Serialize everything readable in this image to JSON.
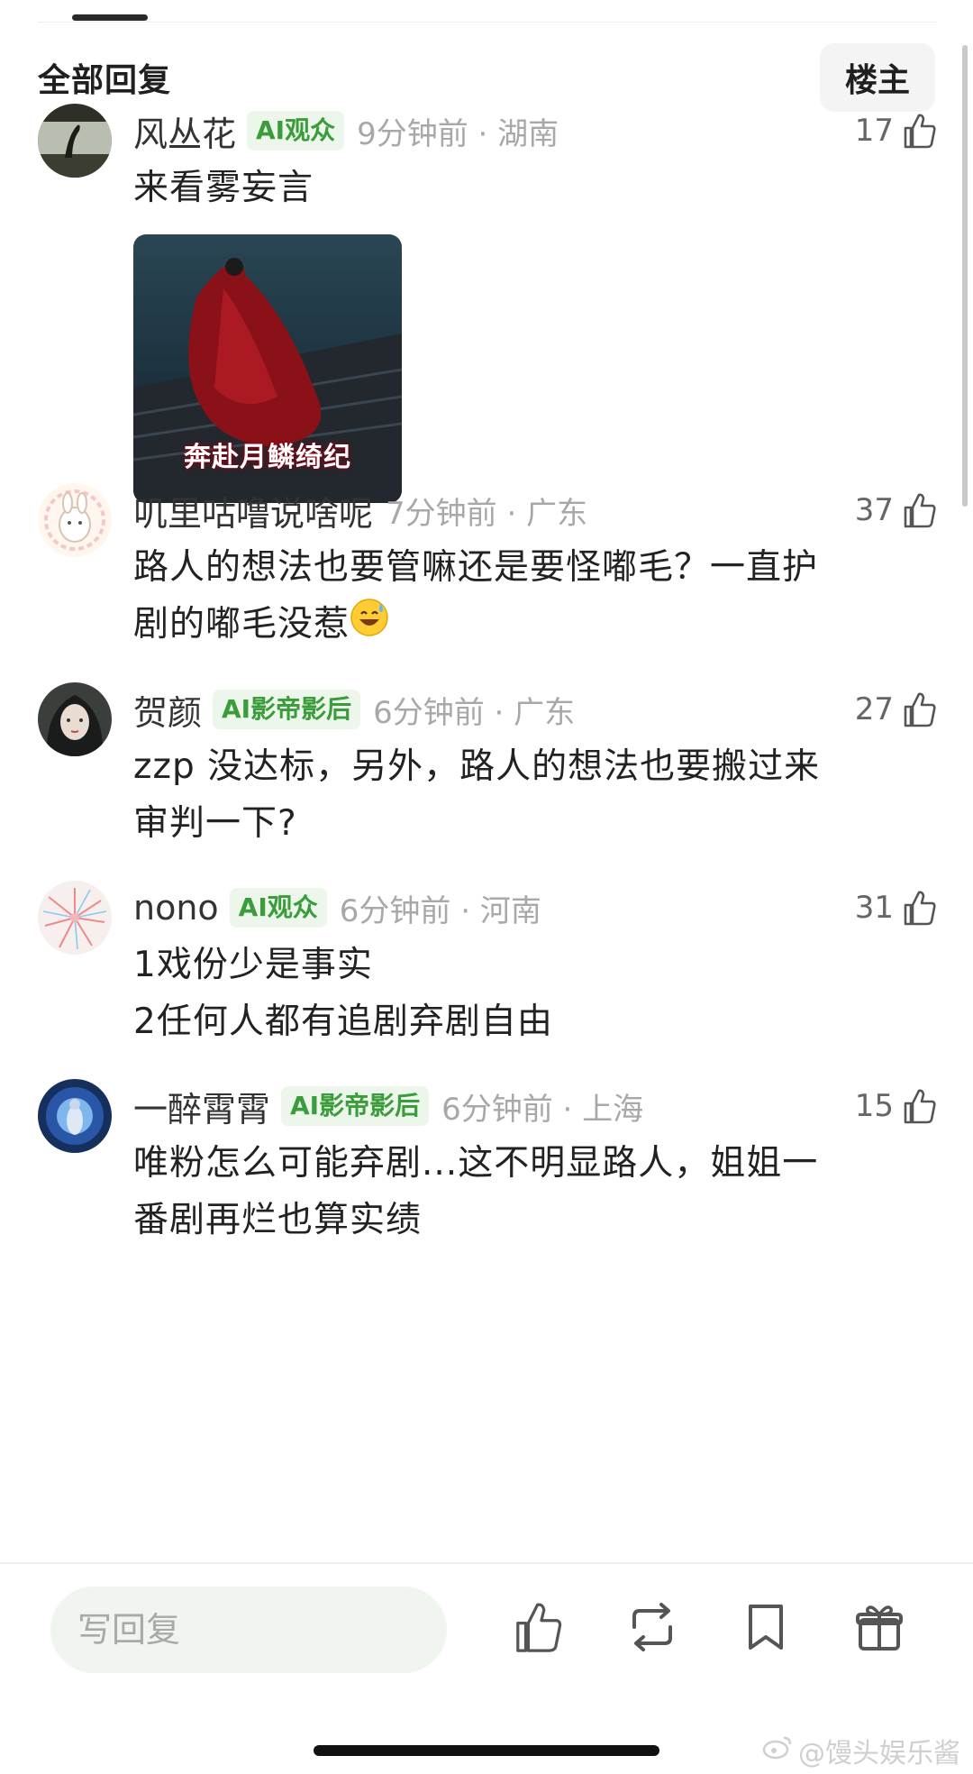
{
  "header": {
    "title": "全部回复",
    "op_label": "楼主"
  },
  "comments": [
    {
      "name": "风丛花",
      "badge": "AI观众",
      "time": "9分钟前 · 湖南",
      "likes": "17",
      "lines": [
        "来看雾妄言"
      ],
      "image_caption": "奔赴月鳞绮纪"
    },
    {
      "name": "叽里咕噜说啥呢",
      "time": "7分钟前 · 广东",
      "likes": "37",
      "lines": [
        "路人的想法也要管嘛还是要怪嘟毛？一直护",
        "剧的嘟毛没惹"
      ],
      "emoji": "sweat-smile-emoji"
    },
    {
      "name": "贺颜",
      "badge": "AI影帝影后",
      "time": "6分钟前 · 广东",
      "likes": "27",
      "lines": [
        "zzp 没达标，另外，路人的想法也要搬过来",
        "审判一下?"
      ]
    },
    {
      "name": "nono",
      "badge": "AI观众",
      "time": "6分钟前 · 河南",
      "likes": "31",
      "lines": [
        "1戏份少是事实",
        "2任何人都有追剧弃剧自由"
      ]
    },
    {
      "name": "一醉霄霄",
      "badge": "AI影帝影后",
      "time": "6分钟前 · 上海",
      "likes": "15",
      "lines": [
        "唯粉怎么可能弃剧...这不明显路人，姐姐一",
        "番剧再烂也算实绩"
      ]
    }
  ],
  "bottom_bar": {
    "reply_placeholder": "写回复",
    "actions": [
      "thumbs-up-icon",
      "repost-icon",
      "bookmark-icon",
      "gift-icon"
    ]
  },
  "watermark": "@馒头娱乐酱",
  "colors": {
    "badge_bg": "#ecf6ea",
    "badge_text": "#3b9c3b",
    "meta_gray": "#a8a8a8"
  }
}
